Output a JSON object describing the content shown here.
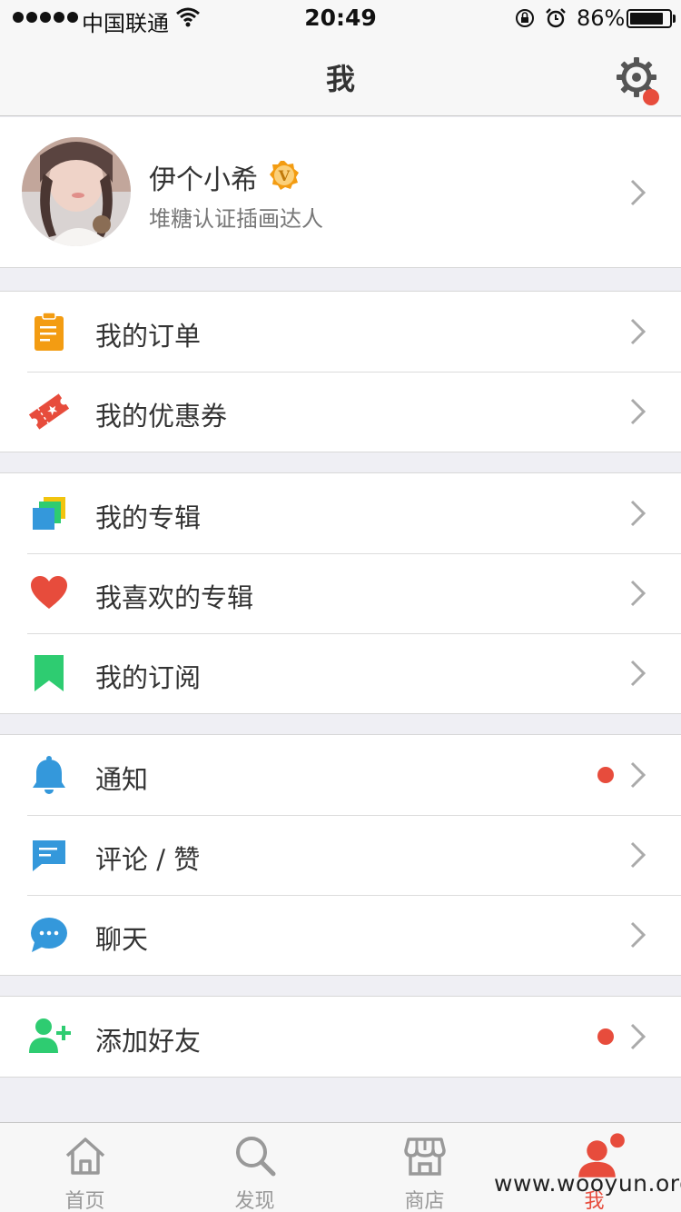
{
  "status_bar": {
    "carrier": "中国联通",
    "time": "20:49",
    "battery_percent": "86%",
    "battery_level": 0.86
  },
  "nav": {
    "title": "我",
    "settings_icon": "gear-icon",
    "settings_has_badge": true
  },
  "profile": {
    "name": "伊个小希",
    "verified_badge_letter": "V",
    "description": "堆糖认证插画达人"
  },
  "menu_groups": [
    {
      "items": [
        {
          "label": "我的订单",
          "icon": "clipboard-icon",
          "color": "#f39c12"
        },
        {
          "label": "我的优惠券",
          "icon": "coupon-icon",
          "color": "#e74c3c"
        }
      ]
    },
    {
      "items": [
        {
          "label": "我的专辑",
          "icon": "album-stack-icon",
          "color": "#3498db"
        },
        {
          "label": "我喜欢的专辑",
          "icon": "heart-icon",
          "color": "#e74c3c"
        },
        {
          "label": "我的订阅",
          "icon": "bookmark-icon",
          "color": "#2ecc71"
        }
      ]
    },
    {
      "items": [
        {
          "label": "通知",
          "icon": "bell-icon",
          "color": "#3498db",
          "badge": true
        },
        {
          "label": "评论 / 赞",
          "icon": "comment-icon",
          "color": "#3498db"
        },
        {
          "label": "聊天",
          "icon": "chat-bubble-icon",
          "color": "#3498db"
        }
      ]
    },
    {
      "items": [
        {
          "label": "添加好友",
          "icon": "add-friend-icon",
          "color": "#2ecc71",
          "badge": true
        }
      ]
    }
  ],
  "tabs": [
    {
      "label": "首页",
      "icon": "home-icon",
      "active": false
    },
    {
      "label": "发现",
      "icon": "search-icon",
      "active": false
    },
    {
      "label": "商店",
      "icon": "store-icon",
      "active": false
    },
    {
      "label": "我",
      "icon": "person-icon",
      "active": true,
      "badge": true
    }
  ],
  "watermark": "www.wooyun.org",
  "colors": {
    "accent": "#e74c3c",
    "background": "#efeff4",
    "verify_badge": "#f39c12"
  }
}
